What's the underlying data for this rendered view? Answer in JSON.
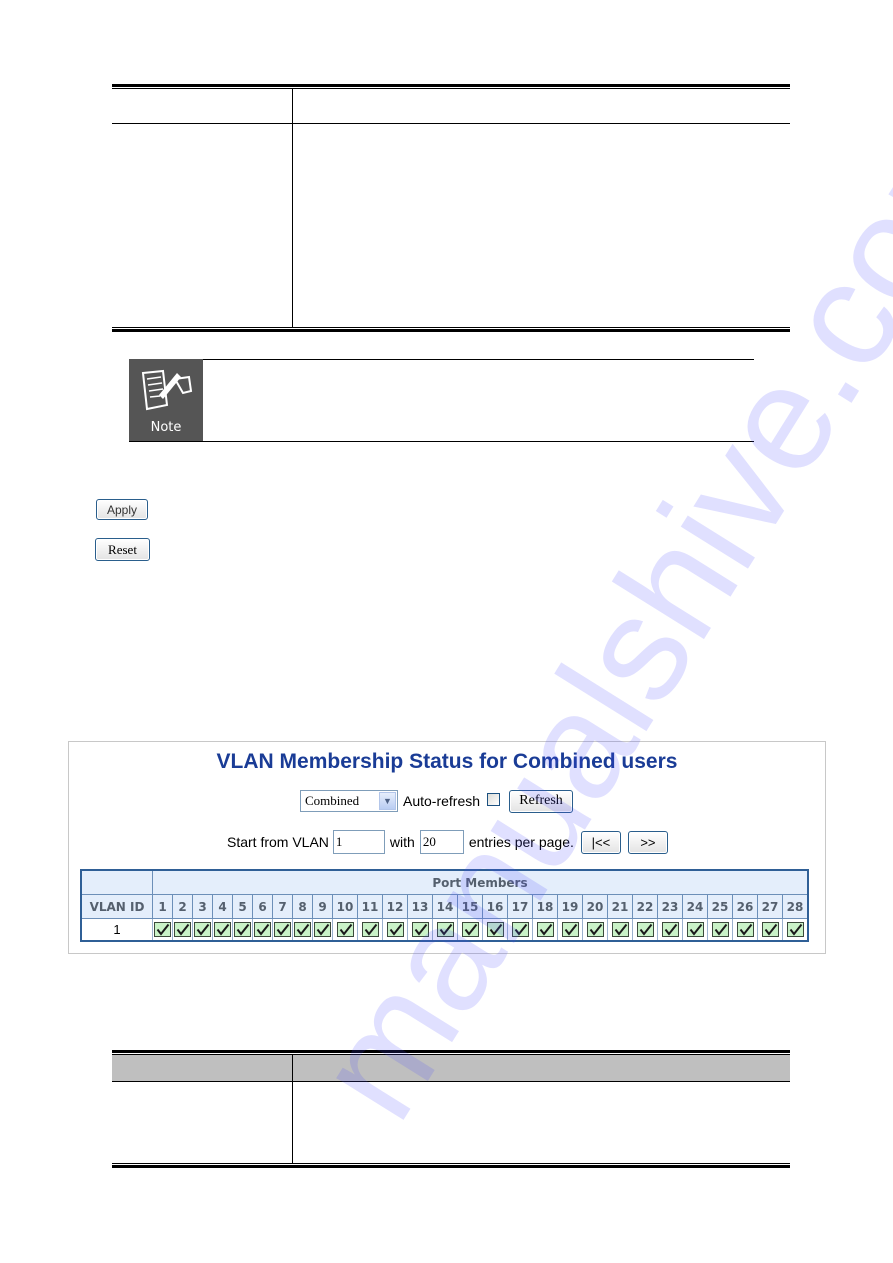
{
  "top_table": {
    "header": [
      "",
      ""
    ],
    "rows": [
      [
        "",
        ""
      ]
    ]
  },
  "note": {
    "icon": "note-pencil-icon",
    "label": "Note",
    "text": ""
  },
  "buttons": {
    "apply": "Apply",
    "reset": "Reset"
  },
  "watermark": "manualshive.com",
  "vlan_panel": {
    "title": "VLAN Membership Status for Combined users",
    "user_select": {
      "value": "Combined"
    },
    "auto_refresh": {
      "label": "Auto-refresh",
      "checked": false
    },
    "refresh_label": "Refresh",
    "start_from_label": "Start from VLAN",
    "start_vlan": "1",
    "with_label": "with",
    "entries": "20",
    "entries_suffix": "entries per page.",
    "first_label": "|<<",
    "next_label": ">>",
    "table": {
      "vlan_id_header": "VLAN ID",
      "port_members_header": "Port Members",
      "ports": [
        "1",
        "2",
        "3",
        "4",
        "5",
        "6",
        "7",
        "8",
        "9",
        "10",
        "11",
        "12",
        "13",
        "14",
        "15",
        "16",
        "17",
        "18",
        "19",
        "20",
        "21",
        "22",
        "23",
        "24",
        "25",
        "26",
        "27",
        "28"
      ],
      "rows": [
        {
          "vlan_id": "1",
          "members": [
            true,
            true,
            true,
            true,
            true,
            true,
            true,
            true,
            true,
            true,
            true,
            true,
            true,
            true,
            true,
            true,
            true,
            true,
            true,
            true,
            true,
            true,
            true,
            true,
            true,
            true,
            true,
            true
          ]
        }
      ]
    },
    "colors": {
      "title": "#1a3c96",
      "header_bg": "#e4eefb",
      "member_check_bg": "#c9f2c7",
      "table_border": "#2f5f96"
    }
  },
  "bottom_table": {
    "header": [
      "",
      ""
    ],
    "rows": [
      [
        "",
        ""
      ]
    ]
  }
}
